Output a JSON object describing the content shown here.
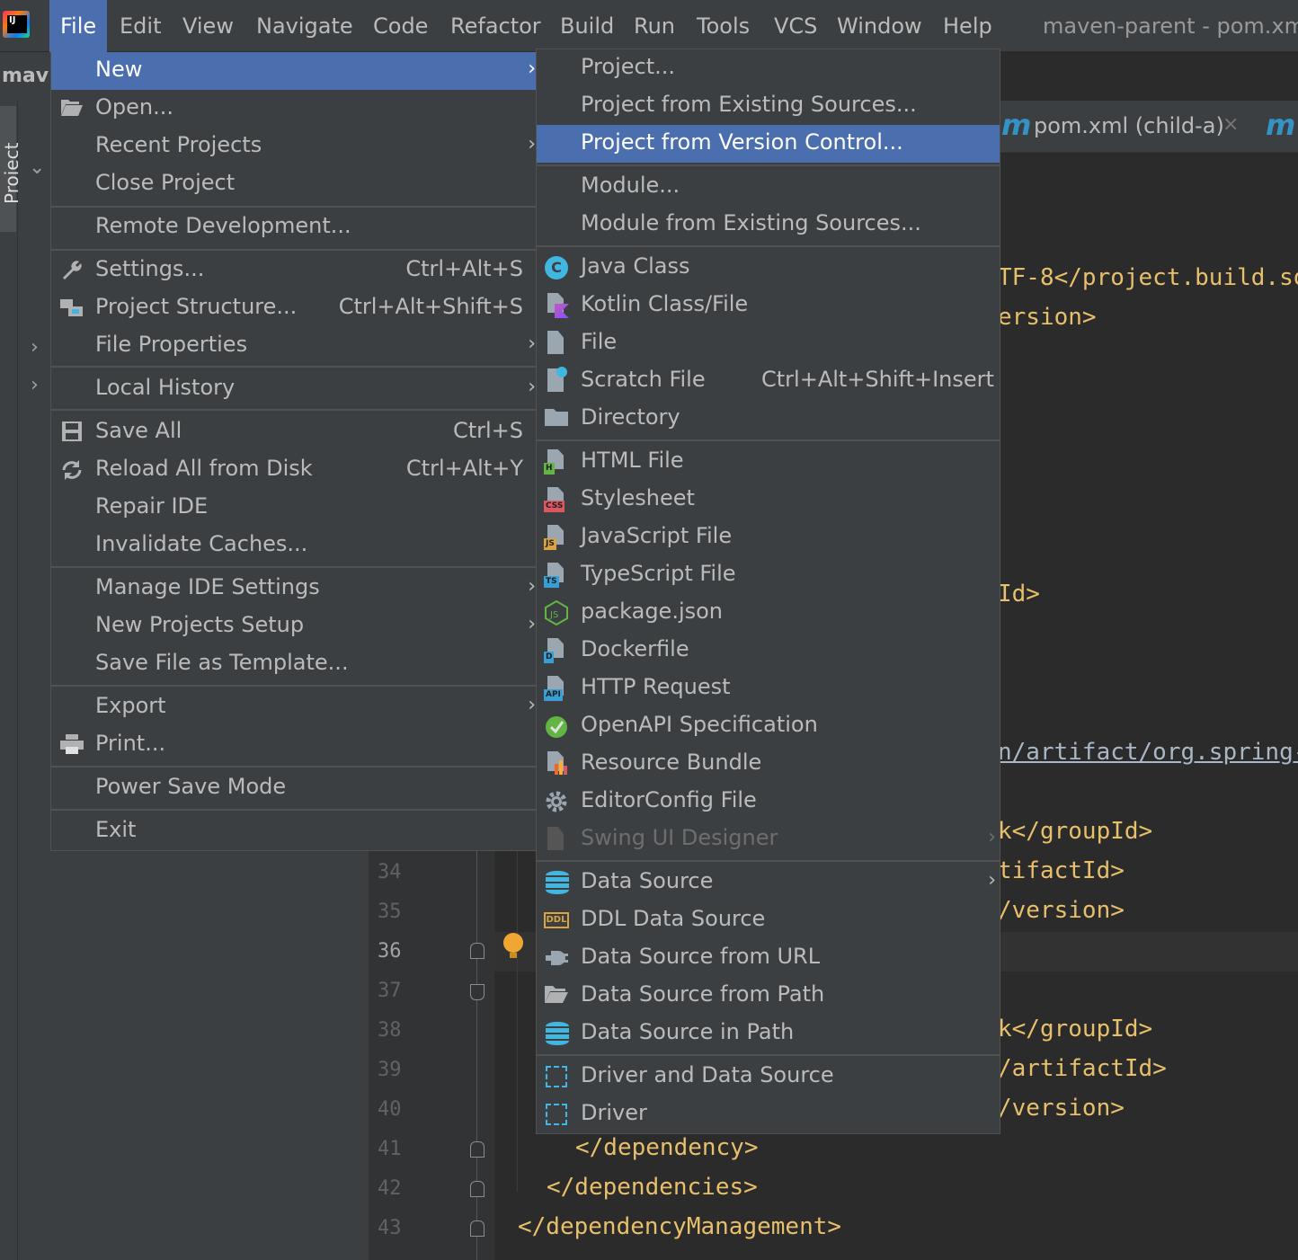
{
  "app": {
    "window_title": "maven-parent - pom.xml"
  },
  "menubar": [
    "File",
    "Edit",
    "View",
    "Navigate",
    "Code",
    "Refactor",
    "Build",
    "Run",
    "Tools",
    "VCS",
    "Window",
    "Help"
  ],
  "project_panel": {
    "label": "mav",
    "tab_label": "Project"
  },
  "editor": {
    "tab_label": "pom.xml (child-a)",
    "tab_close": "×",
    "maven_icon": "m",
    "line_numbers": [
      "34",
      "35",
      "36",
      "37",
      "38",
      "39",
      "40",
      "41",
      "42",
      "43"
    ],
    "code": {
      "l1": "TF-8</project.build.so",
      "l2": "ersion>",
      "l3": "Id>",
      "l4": "n/artifact/org.spring-",
      "l5": "k</groupId>",
      "l6": "tifactId>",
      "l7": "/version>",
      "l8": "k</groupId>",
      "l9": "/artifactId>",
      "l10": "/version>",
      "l11": "</dependency>",
      "l12": "</dependencies>",
      "l13": "</dependencyManagement>"
    }
  },
  "file_menu": {
    "items": [
      {
        "label": "New",
        "arrow": "›"
      },
      {
        "label": "Open...",
        "icon": "folder-open-icon"
      },
      {
        "label": "Recent Projects",
        "arrow": "›"
      },
      {
        "label": "Close Project"
      },
      {
        "label": "Remote Development..."
      },
      {
        "label": "Settings...",
        "shortcut": "Ctrl+Alt+S",
        "icon": "wrench-icon"
      },
      {
        "label": "Project Structure...",
        "shortcut": "Ctrl+Alt+Shift+S",
        "icon": "project-structure-icon"
      },
      {
        "label": "File Properties",
        "arrow": "›"
      },
      {
        "label": "Local History",
        "arrow": "›"
      },
      {
        "label": "Save All",
        "shortcut": "Ctrl+S",
        "icon": "save-icon"
      },
      {
        "label": "Reload All from Disk",
        "shortcut": "Ctrl+Alt+Y",
        "icon": "reload-icon"
      },
      {
        "label": "Repair IDE"
      },
      {
        "label": "Invalidate Caches..."
      },
      {
        "label": "Manage IDE Settings",
        "arrow": "›"
      },
      {
        "label": "New Projects Setup",
        "arrow": "›"
      },
      {
        "label": "Save File as Template..."
      },
      {
        "label": "Export",
        "arrow": "›"
      },
      {
        "label": "Print...",
        "icon": "printer-icon"
      },
      {
        "label": "Power Save Mode"
      },
      {
        "label": "Exit"
      }
    ]
  },
  "new_menu": {
    "items": [
      {
        "label": "Project..."
      },
      {
        "label": "Project from Existing Sources..."
      },
      {
        "label": "Project from Version Control..."
      },
      {
        "label": "Module..."
      },
      {
        "label": "Module from Existing Sources..."
      },
      {
        "label": "Java Class",
        "icon": "java-class-icon",
        "badge": "C"
      },
      {
        "label": "Kotlin Class/File",
        "icon": "kotlin-file-icon"
      },
      {
        "label": "File",
        "icon": "file-icon"
      },
      {
        "label": "Scratch File",
        "shortcut": "Ctrl+Alt+Shift+Insert",
        "icon": "scratch-file-icon"
      },
      {
        "label": "Directory",
        "icon": "folder-icon"
      },
      {
        "label": "HTML File",
        "icon": "html-file-icon",
        "badge": "H"
      },
      {
        "label": "Stylesheet",
        "icon": "css-file-icon",
        "badge": "CSS"
      },
      {
        "label": "JavaScript File",
        "icon": "js-file-icon",
        "badge": "JS"
      },
      {
        "label": "TypeScript File",
        "icon": "ts-file-icon",
        "badge": "TS"
      },
      {
        "label": "package.json",
        "icon": "nodejs-icon",
        "badge": "JS"
      },
      {
        "label": "Dockerfile",
        "icon": "docker-file-icon",
        "badge": "D"
      },
      {
        "label": "HTTP Request",
        "icon": "http-request-icon",
        "badge": "API"
      },
      {
        "label": "OpenAPI Specification",
        "icon": "openapi-icon"
      },
      {
        "label": "Resource Bundle",
        "icon": "resource-bundle-icon"
      },
      {
        "label": "EditorConfig File",
        "icon": "gear-icon"
      },
      {
        "label": "Swing UI Designer",
        "arrow": "›",
        "icon": "swing-designer-icon"
      },
      {
        "label": "Data Source",
        "arrow": "›",
        "icon": "database-icon"
      },
      {
        "label": "DDL Data Source",
        "icon": "ddl-icon",
        "badge": "DDL"
      },
      {
        "label": "Data Source from URL",
        "icon": "plug-icon"
      },
      {
        "label": "Data Source from Path",
        "icon": "folder-open-icon"
      },
      {
        "label": "Data Source in Path",
        "icon": "database-icon"
      },
      {
        "label": "Driver and Data Source",
        "icon": "driver-icon"
      },
      {
        "label": "Driver",
        "icon": "driver-icon"
      }
    ]
  },
  "colors": {
    "menu_bg": "#3c3f41",
    "selection": "#4b6eaf",
    "text": "#bbbbbb",
    "code_tag": "#e8bf6a",
    "accent_blue": "#40b6e0"
  }
}
